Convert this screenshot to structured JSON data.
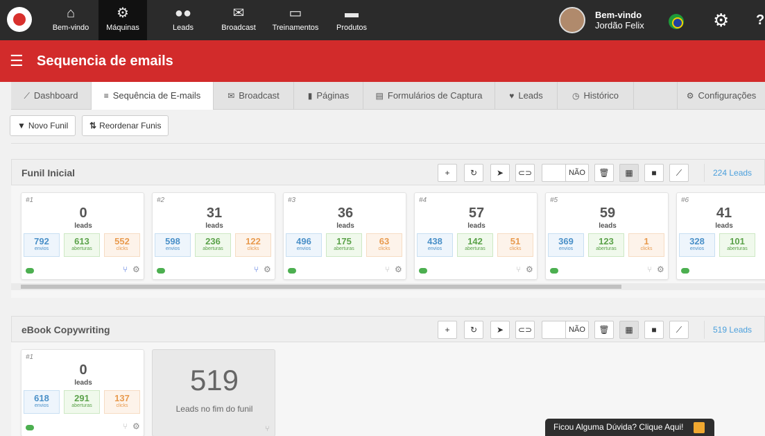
{
  "nav": {
    "items": [
      {
        "label": "Bem-vindo",
        "icon": "home-icon"
      },
      {
        "label": "Máquinas",
        "icon": "gears-icon"
      },
      {
        "label": "Leads",
        "icon": "users-icon"
      },
      {
        "label": "Broadcast",
        "icon": "envelope-icon"
      },
      {
        "label": "Treinamentos",
        "icon": "book-icon"
      },
      {
        "label": "Produtos",
        "icon": "briefcase-icon"
      }
    ],
    "active": "Máquinas",
    "welcome": "Bem-vindo",
    "user_name": "Jordão Felix"
  },
  "header": {
    "title": "Sequencia de emails"
  },
  "tabs": [
    {
      "label": "Dashboard",
      "icon": "chart-icon"
    },
    {
      "label": "Sequência de E-mails",
      "icon": "list-icon"
    },
    {
      "label": "Broadcast",
      "icon": "envelope-icon"
    },
    {
      "label": "Páginas",
      "icon": "file-icon"
    },
    {
      "label": "Formulários de Captura",
      "icon": "form-icon"
    },
    {
      "label": "Leads",
      "icon": "heart-icon"
    },
    {
      "label": "Histórico",
      "icon": "clock-icon"
    },
    {
      "label": "Configurações",
      "icon": "cogs-icon"
    }
  ],
  "actions": {
    "new_funnel": "Novo Funil",
    "reorder": "Reordenar Funis"
  },
  "toolbar": {
    "nao": "NÃO"
  },
  "labels": {
    "leads": "leads",
    "envios": "envios",
    "aberturas": "aberturas",
    "clicks": "clicks"
  },
  "funnels": [
    {
      "name": "Funil Inicial",
      "leads_link": "224 Leads",
      "steps": [
        {
          "num": "#1",
          "leads": "0",
          "envios": "792",
          "aberturas": "613",
          "clicks": "552"
        },
        {
          "num": "#2",
          "leads": "31",
          "envios": "598",
          "aberturas": "236",
          "clicks": "122"
        },
        {
          "num": "#3",
          "leads": "36",
          "envios": "496",
          "aberturas": "175",
          "clicks": "63"
        },
        {
          "num": "#4",
          "leads": "57",
          "envios": "438",
          "aberturas": "142",
          "clicks": "51"
        },
        {
          "num": "#5",
          "leads": "59",
          "envios": "369",
          "aberturas": "123",
          "clicks": "1"
        },
        {
          "num": "#6",
          "leads": "41",
          "envios": "328",
          "aberturas": "101",
          "clicks": ""
        }
      ]
    },
    {
      "name": "eBook Copywriting",
      "leads_link": "519 Leads",
      "steps": [
        {
          "num": "#1",
          "leads": "0",
          "envios": "618",
          "aberturas": "291",
          "clicks": "137"
        }
      ],
      "end": {
        "count": "519",
        "label": "Leads no fim do funil"
      }
    }
  ],
  "help": "Ficou Alguma Dúvida? Clique Aqui!"
}
